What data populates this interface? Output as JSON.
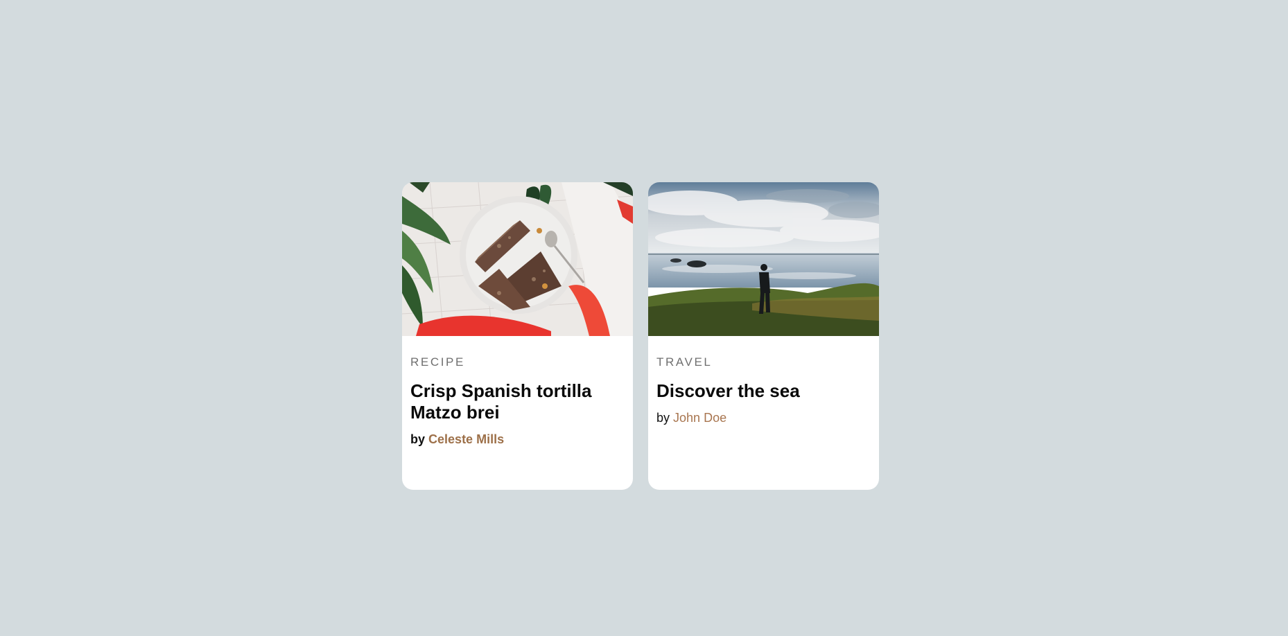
{
  "colors": {
    "background": "#d3dbde",
    "card": "#ffffff",
    "accent": "#a8754f"
  },
  "cards": [
    {
      "image_alt": "plate of tortilla slices",
      "category": "RECIPE",
      "title": "Crisp Spanish tortilla Matzo brei",
      "by": "by",
      "author": "Celeste Mills"
    },
    {
      "image_alt": "person looking at the sea",
      "category": "TRAVEL",
      "title": "Discover the sea",
      "by": "by",
      "author": "John Doe"
    }
  ]
}
